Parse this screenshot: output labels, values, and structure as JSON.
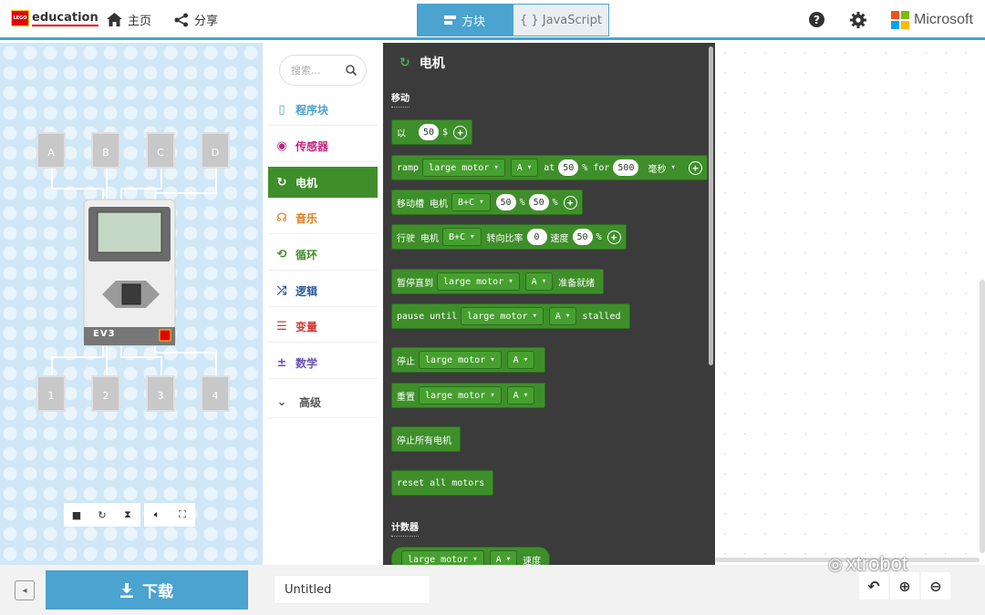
{
  "header": {
    "brand": "education",
    "home_label": "主页",
    "share_label": "分享",
    "mode_blocks": "方块",
    "mode_js": "{ } JavaScript",
    "microsoft": "Microsoft",
    "accent": "#4ba3cf"
  },
  "simulator": {
    "ports_top": [
      "A",
      "B",
      "C",
      "D"
    ],
    "ports_bottom": [
      "1",
      "2",
      "3",
      "4"
    ],
    "brick_label": "EV3",
    "controls": [
      "stop-icon",
      "restart-icon",
      "slowmo-icon",
      "sound-icon",
      "fullscreen-icon"
    ]
  },
  "categories": {
    "search_placeholder": "搜索...",
    "items": [
      {
        "label": "程序块",
        "color": "#4ba3cf",
        "icon": "▯"
      },
      {
        "label": "传感器",
        "color": "#c2277e",
        "icon": "◉"
      },
      {
        "label": "电机",
        "color": "#3e8f2a",
        "icon": "↻"
      },
      {
        "label": "音乐",
        "color": "#e07b19",
        "icon": "☊"
      },
      {
        "label": "循环",
        "color": "#3e8f2a",
        "icon": "⟲"
      },
      {
        "label": "逻辑",
        "color": "#2c5aa0",
        "icon": "⤮"
      },
      {
        "label": "变量",
        "color": "#d13a32",
        "icon": "☰"
      },
      {
        "label": "数学",
        "color": "#6a4fb0",
        "icon": "±"
      },
      {
        "label": "高级",
        "color": "#555555",
        "icon": "⌄"
      }
    ]
  },
  "flyout": {
    "title": "电机",
    "section_move": "移动",
    "section_counter": "计数器",
    "b1": {
      "w1": "以",
      "n1": "50",
      "w2": "$"
    },
    "b2": {
      "w1": "ramp",
      "d1": "large motor",
      "d2": "A",
      "w2": "at",
      "n1": "50",
      "w3": "% for",
      "n2": "500",
      "d3": "毫秒"
    },
    "b3": {
      "w1": "移动槽 电机",
      "d1": "B+C",
      "n1": "50",
      "w2": "%",
      "n2": "50",
      "w3": "%"
    },
    "b4": {
      "w1": "行驶 电机",
      "d1": "B+C",
      "w2": "转向比率",
      "n1": "0",
      "w3": "速度",
      "n2": "50",
      "w4": "%"
    },
    "b5": {
      "w1": "暂停直到",
      "d1": "large motor",
      "d2": "A",
      "w2": "准备就绪"
    },
    "b6": {
      "w1": "pause until",
      "d1": "large motor",
      "d2": "A",
      "w2": "stalled"
    },
    "b7": {
      "w1": "停止",
      "d1": "large motor",
      "d2": "A"
    },
    "b8": {
      "w1": "重置",
      "d1": "large motor",
      "d2": "A"
    },
    "b9": {
      "w1": "停止所有电机"
    },
    "b10": {
      "w1": "reset all motors"
    },
    "b11": {
      "d1": "large motor",
      "d2": "A",
      "w1": "速度"
    }
  },
  "footer": {
    "download_label": "下载",
    "project_name": "Untitled",
    "watermark": "xtrobot"
  }
}
